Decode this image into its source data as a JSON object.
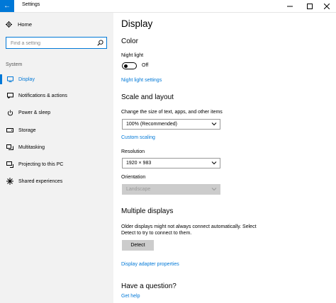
{
  "window": {
    "title": "Settings"
  },
  "sidebar": {
    "home_label": "Home",
    "search_placeholder": "Find a setting",
    "section_label": "System",
    "items": [
      {
        "label": "Display",
        "icon": "monitor-icon",
        "active": true
      },
      {
        "label": "Notifications & actions",
        "icon": "notification-icon",
        "active": false
      },
      {
        "label": "Power & sleep",
        "icon": "power-icon",
        "active": false
      },
      {
        "label": "Storage",
        "icon": "storage-icon",
        "active": false
      },
      {
        "label": "Multitasking",
        "icon": "multitasking-icon",
        "active": false
      },
      {
        "label": "Projecting to this PC",
        "icon": "projecting-icon",
        "active": false
      },
      {
        "label": "Shared experiences",
        "icon": "shared-icon",
        "active": false
      }
    ]
  },
  "main": {
    "title": "Display",
    "color": {
      "heading": "Color",
      "night_light_label": "Night light",
      "night_light_state": "Off",
      "night_light_settings_link": "Night light settings"
    },
    "scale": {
      "heading": "Scale and layout",
      "size_label": "Change the size of text, apps, and other items",
      "size_value": "100% (Recommended)",
      "custom_scaling_link": "Custom scaling",
      "resolution_label": "Resolution",
      "resolution_value": "1920 × 983",
      "orientation_label": "Orientation",
      "orientation_value": "Landscape"
    },
    "multiple": {
      "heading": "Multiple displays",
      "description": "Older displays might not always connect automatically. Select Detect to try to connect to them.",
      "detect_button": "Detect",
      "adapter_link": "Display adapter properties"
    },
    "question": {
      "heading": "Have a question?",
      "help_link": "Get help"
    }
  },
  "colors": {
    "accent": "#0078d7",
    "sidebar_bg": "#f2f2f2",
    "button_bg": "#cccccc"
  }
}
